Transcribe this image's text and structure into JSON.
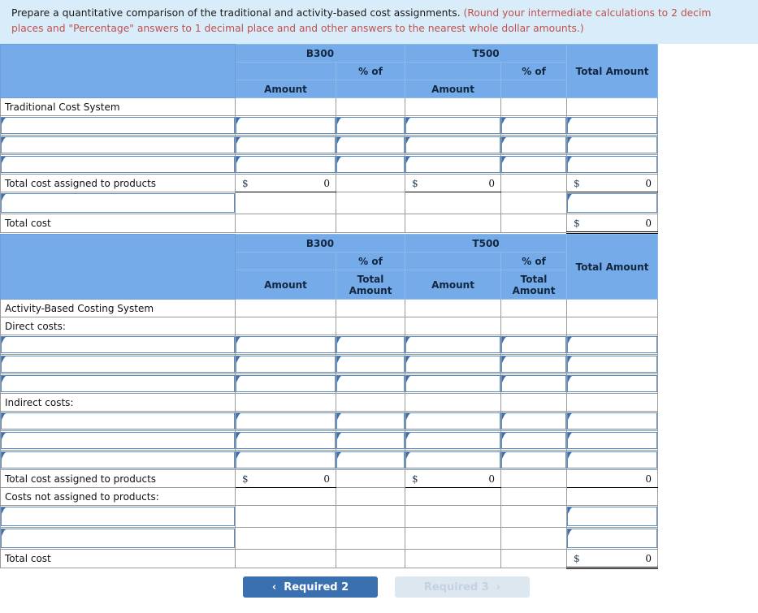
{
  "banner": {
    "main": "Prepare a quantitative comparison of the traditional and activity-based cost assignments.",
    "note_line1": "(Round your intermediate calculations to 2 decim",
    "note_line2": "places and \"Percentage\" answers to 1 decimal place and and other answers to the nearest whole dollar amounts.)"
  },
  "colors": {
    "header_blue": "#75abe8",
    "banner_bg": "#d9ecfa",
    "note_red": "#c0504d",
    "primary_button": "#3a6fb0",
    "muted_button": "#dde7f0",
    "field_border": "#5c8cc0"
  },
  "table1": {
    "headers": {
      "product_b": "B300",
      "product_t": "T500",
      "pct_of_b": "% of",
      "pct_of_t": "% of",
      "amount_b": "Amount",
      "amount_t": "Amount",
      "total_amount": "Total Amount"
    },
    "rows": [
      {
        "type": "label",
        "label": "Traditional Cost System"
      },
      {
        "type": "inputs",
        "label": "",
        "cells": [
          "input",
          "input",
          "input",
          "input",
          "input",
          "input"
        ]
      },
      {
        "type": "inputs",
        "label": "",
        "cells": [
          "input",
          "input",
          "input",
          "input",
          "input",
          "input"
        ]
      },
      {
        "type": "inputs",
        "label": "",
        "cells": [
          "input",
          "input",
          "input",
          "input",
          "input",
          "input"
        ]
      },
      {
        "type": "totals",
        "label": "Total cost assigned to products",
        "b_amount_currency": "$",
        "b_amount": "0",
        "b_pct": "",
        "t_amount_currency": "$",
        "t_amount": "0",
        "t_pct": "",
        "total_currency": "$",
        "total": "0"
      },
      {
        "type": "inputs_partial",
        "label": "",
        "cells": [
          "input",
          "",
          "",
          "",
          "",
          "input"
        ]
      },
      {
        "type": "grandtotal",
        "label": "Total cost",
        "total_currency": "$",
        "total": "0"
      }
    ]
  },
  "table2": {
    "headers": {
      "product_b": "B300",
      "product_t": "T500",
      "pct_of_b_line1": "% of",
      "pct_of_b_line2": "Total",
      "pct_of_b_line3": "Amount",
      "pct_of_t_line1": "% of",
      "pct_of_t_line2": "Total",
      "pct_of_t_line3": "Amount",
      "amount_b": "Amount",
      "amount_t": "Amount",
      "total_amount": "Total Amount"
    },
    "rows": [
      {
        "type": "label",
        "label": "Activity-Based Costing System"
      },
      {
        "type": "label",
        "label": "Direct costs:"
      },
      {
        "type": "inputs",
        "label": "",
        "cells": [
          "input",
          "input",
          "input",
          "input",
          "input",
          "input"
        ]
      },
      {
        "type": "inputs",
        "label": "",
        "cells": [
          "input",
          "input",
          "input",
          "input",
          "input",
          "input"
        ]
      },
      {
        "type": "inputs",
        "label": "",
        "cells": [
          "input",
          "input",
          "input",
          "input",
          "input",
          "input"
        ]
      },
      {
        "type": "label",
        "label": "Indirect costs:"
      },
      {
        "type": "inputs",
        "label": "",
        "cells": [
          "input",
          "input",
          "input",
          "input",
          "input",
          "input"
        ]
      },
      {
        "type": "inputs",
        "label": "",
        "cells": [
          "input",
          "input",
          "input",
          "input",
          "input",
          "input"
        ]
      },
      {
        "type": "inputs",
        "label": "",
        "cells": [
          "input",
          "input",
          "input",
          "input",
          "input",
          "input"
        ]
      },
      {
        "type": "totals",
        "label": "Total cost assigned to products",
        "b_amount_currency": "$",
        "b_amount": "0",
        "b_pct": "",
        "t_amount_currency": "$",
        "t_amount": "0",
        "t_pct": "",
        "total_currency": "",
        "total": "0"
      },
      {
        "type": "label",
        "label": "Costs not assigned to products:"
      },
      {
        "type": "inputs_partial",
        "label": "",
        "cells": [
          "input",
          "",
          "",
          "",
          "",
          "input"
        ]
      },
      {
        "type": "inputs_partial",
        "label": "",
        "cells": [
          "input",
          "",
          "",
          "",
          "",
          "input"
        ]
      },
      {
        "type": "grandtotal",
        "label": "Total cost",
        "total_currency": "$",
        "total": "0"
      }
    ]
  },
  "footer": {
    "prev_button": "Required 2",
    "next_button": "Required 3",
    "prev_chevron": "‹",
    "next_chevron": "›"
  }
}
